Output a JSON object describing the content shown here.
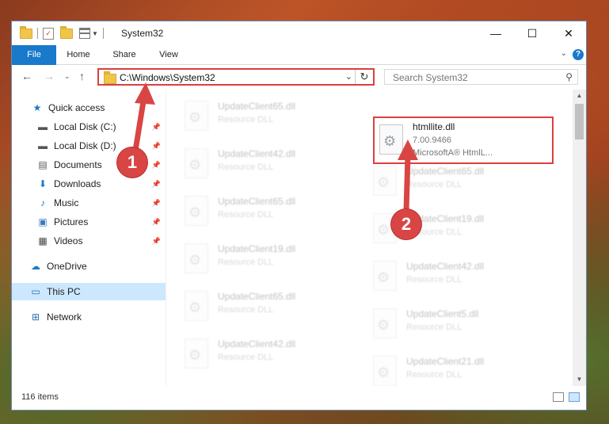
{
  "window": {
    "title": "System32"
  },
  "window_controls": {
    "minimize": "—",
    "maximize": "☐",
    "close": "✕"
  },
  "ribbon": {
    "tabs": [
      "File",
      "Home",
      "Share",
      "View"
    ],
    "help": "?",
    "expand": "⌄"
  },
  "address": {
    "path": "C:\\Windows\\System32",
    "refresh": "↻",
    "dropdown": "⌄"
  },
  "search": {
    "placeholder": "Search System32"
  },
  "sidebar": {
    "items": [
      {
        "label": "Quick access",
        "icon": "star-icon"
      },
      {
        "label": "Local Disk (C:)",
        "icon": "drive-icon",
        "pinned": true
      },
      {
        "label": "Local Disk (D:)",
        "icon": "drive-icon",
        "pinned": true
      },
      {
        "label": "Documents",
        "icon": "documents-icon",
        "pinned": true
      },
      {
        "label": "Downloads",
        "icon": "download-icon",
        "pinned": true
      },
      {
        "label": "Music",
        "icon": "music-icon",
        "pinned": true
      },
      {
        "label": "Pictures",
        "icon": "pictures-icon",
        "pinned": true
      },
      {
        "label": "Videos",
        "icon": "videos-icon",
        "pinned": true
      },
      {
        "label": "OneDrive",
        "icon": "cloud-icon"
      },
      {
        "label": "This PC",
        "icon": "computer-icon",
        "selected": true
      },
      {
        "label": "Network",
        "icon": "network-icon"
      }
    ]
  },
  "files": {
    "highlighted": {
      "name": "htmllite.dll",
      "version": "7.00.9466",
      "company": "MicrosoftA® HtmlL..."
    },
    "left_column": [
      {
        "name": "UpdateClient65.dll",
        "desc": "Resource DLL"
      },
      {
        "name": "UpdateClient42.dll",
        "desc": "Resource DLL"
      },
      {
        "name": "UpdateClient65.dll",
        "desc": "Resource DLL"
      },
      {
        "name": "UpdateClient19.dll",
        "desc": "Resource DLL"
      },
      {
        "name": "UpdateClient65.dll",
        "desc": "Resource DLL"
      },
      {
        "name": "UpdateClient42.dll",
        "desc": "Resource DLL"
      }
    ],
    "right_column": [
      {
        "name": "UpdateClient65.dll",
        "desc": "Resource DLL"
      },
      {
        "name": "UpdateClient19.dll",
        "desc": "Resource DLL"
      },
      {
        "name": "UpdateClient42.dll",
        "desc": "Resource DLL"
      },
      {
        "name": "UpdateClient5.dll",
        "desc": "Resource DLL"
      },
      {
        "name": "UpdateClient21.dll",
        "desc": "Resource DLL"
      }
    ]
  },
  "status": {
    "item_count": "116 items"
  },
  "callouts": [
    "1",
    "2"
  ],
  "colors": {
    "accent": "#1979ca",
    "highlight": "#d94040",
    "selected_bg": "#cce8ff"
  }
}
